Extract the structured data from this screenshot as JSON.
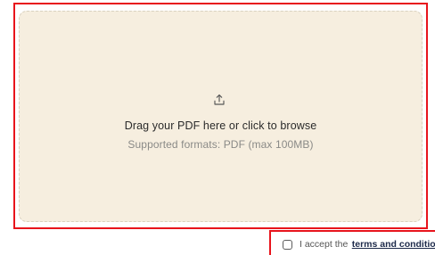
{
  "upload": {
    "icon": "upload-icon",
    "title": "Drag your PDF here or click to browse",
    "subtitle": "Supported formats: PDF (max 100MB)"
  },
  "terms": {
    "label": "I accept the",
    "link": "terms and conditions",
    "checked": false
  },
  "colors": {
    "dropzone_background": "#f6eedf",
    "dropzone_border": "#d9d1bf",
    "highlight_border": "#e8141c",
    "link": "#1d2a4a"
  }
}
